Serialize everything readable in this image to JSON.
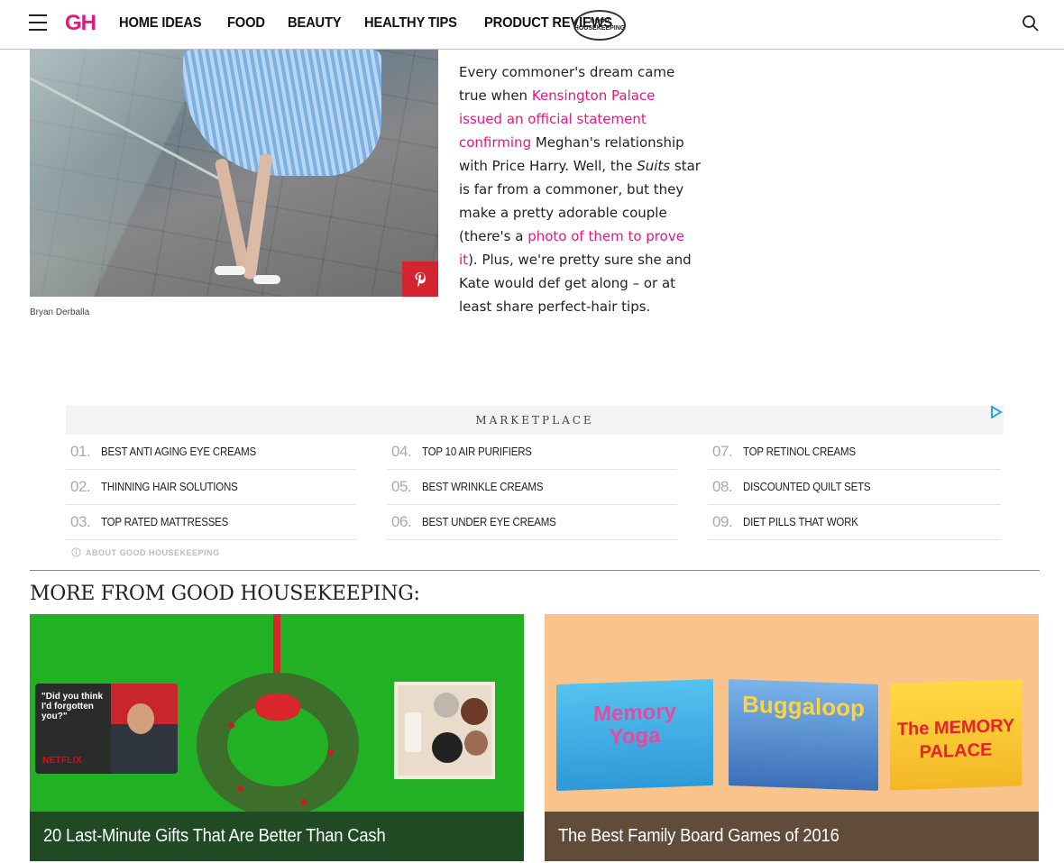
{
  "header": {
    "logo": "GH",
    "nav": [
      "HOME IDEAS",
      "FOOD",
      "BEAUTY",
      "HEALTHY TIPS",
      "PRODUCT REVIEWS"
    ],
    "seal": [
      "GOOD",
      "HOUSEKEEPING"
    ]
  },
  "article": {
    "photo_credit": "Bryan Derballa",
    "p1": "Every commoner's dream came true when ",
    "link1": "Kensington Palace issued an official statement confirming",
    "p2": " Meghan's relationship with Price Harry. Well, the ",
    "em": "Suits",
    "p3": " star is far from a commoner, but they make a pretty adorable couple (there's a ",
    "link2": "photo of them to prove it",
    "p4": "). Plus, we're pretty sure she and Kate would def get along – or at least share perfect-hair tips."
  },
  "marketplace": {
    "title": "MARKETPLACE",
    "about": "ABOUT GOOD HOUSEKEEPING",
    "columns": [
      [
        {
          "num": "01.",
          "label": "BEST ANTI AGING EYE CREAMS"
        },
        {
          "num": "02.",
          "label": "THINNING HAIR SOLUTIONS"
        },
        {
          "num": "03.",
          "label": "TOP RATED MATTRESSES"
        }
      ],
      [
        {
          "num": "04.",
          "label": "TOP 10 AIR PURIFIERS"
        },
        {
          "num": "05.",
          "label": "BEST WRINKLE CREAMS"
        },
        {
          "num": "06.",
          "label": "BEST UNDER EYE CREAMS"
        }
      ],
      [
        {
          "num": "07.",
          "label": "TOP RETINOL CREAMS"
        },
        {
          "num": "08.",
          "label": "DISCOUNTED QUILT SETS"
        },
        {
          "num": "09.",
          "label": "DIET PILLS THAT WORK"
        }
      ]
    ]
  },
  "more": {
    "title": "MORE FROM GOOD HOUSEKEEPING:",
    "cards": [
      {
        "caption": "20 Last-Minute Gifts That Are Better Than Cash",
        "gift_card_text": "\"Did you think I'd forgotten you?\"",
        "gift_card_brand": "NETFLIX"
      },
      {
        "caption": "The Best Family Board Games of 2016",
        "games": [
          "Memory Yoga",
          "Buggaloop",
          "The MEMORY PALACE"
        ]
      }
    ]
  },
  "colors": {
    "brand_pink": "#e6177e",
    "pinterest_red": "#d32430",
    "card1_bg": "#22b024",
    "card2_bg": "#f9c48b"
  }
}
